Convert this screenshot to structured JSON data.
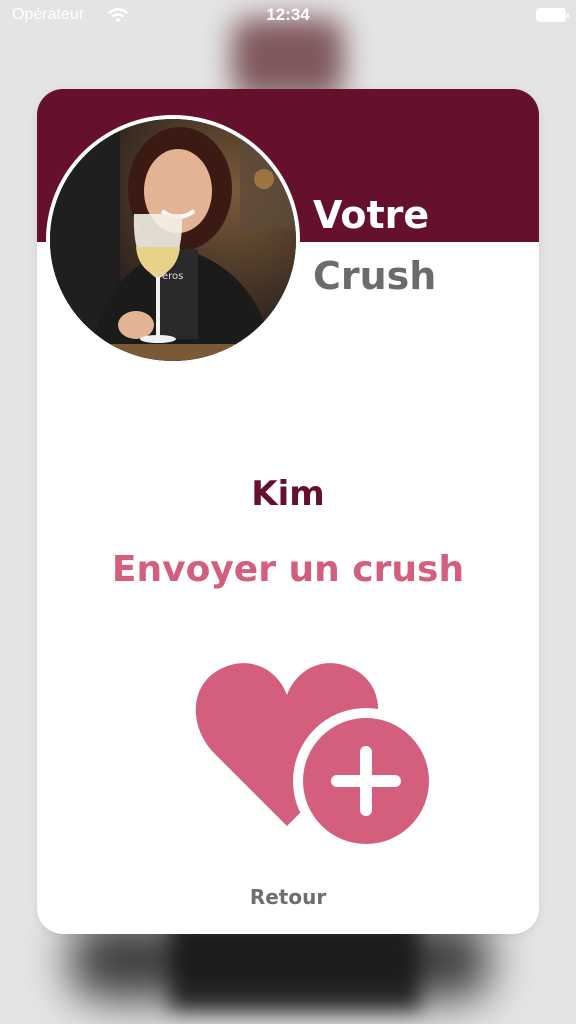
{
  "status_bar": {
    "carrier": "Opérateur",
    "time": "12:34"
  },
  "card": {
    "title_line1": "Votre",
    "title_line2": "Crush",
    "name": "Kim",
    "action_label": "Envoyer un crush",
    "back_label": "Retour"
  },
  "icons": {
    "status": [
      "wifi-icon",
      "battery-icon"
    ],
    "action": "heart-plus-icon"
  },
  "colors": {
    "brand": "#65112c",
    "accent": "#d45f7c",
    "muted_text": "#6b6b6b"
  }
}
